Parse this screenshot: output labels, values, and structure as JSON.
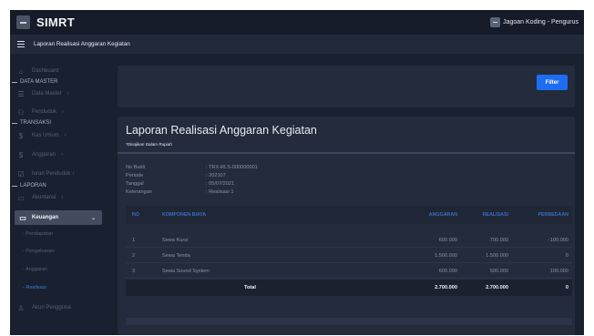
{
  "app": {
    "brand": "SIMRT",
    "user": "Jagoan Koding - Pengurus"
  },
  "subbar": {
    "title": "Laporan Realisasi Anggaran Kegiatan"
  },
  "sidebar": {
    "items": [
      {
        "label": "Dashboard",
        "icon": "home-icon"
      },
      {
        "header": "DATA MASTER"
      },
      {
        "label": "Data Master",
        "icon": "database-icon"
      },
      {
        "label": "Penduduk",
        "icon": "users-icon"
      },
      {
        "header": "TRANSAKSI"
      },
      {
        "label": "Kas Umum",
        "icon": "dollar-icon"
      },
      {
        "label": "Anggaran",
        "icon": "dollar-icon"
      },
      {
        "label": "Iuran Penduduk",
        "icon": "checkbox-icon"
      },
      {
        "header": "LAPORAN"
      },
      {
        "label": "Akuntansi",
        "icon": "monitor-icon"
      },
      {
        "label": "Keuangan",
        "icon": "monitor-icon"
      },
      {
        "label": "- Pendapatan"
      },
      {
        "label": "- Pengeluaran"
      },
      {
        "label": "- Anggaran"
      },
      {
        "label": "- Realisasi"
      },
      {
        "label": "Akun Pengguna",
        "icon": "user-icon"
      }
    ]
  },
  "filter": {
    "button": "Filter"
  },
  "report": {
    "title": "Laporan Realisasi Anggaran Kegiatan",
    "note": "*Disajikan Dalam Rupiah",
    "meta": [
      {
        "label": "No Bukti",
        "value": ": TRX-RLS-000000001"
      },
      {
        "label": "Periode",
        "value": ": 202107"
      },
      {
        "label": "Tanggal",
        "value": ": 05/07/2021"
      },
      {
        "label": "Keterangan",
        "value": ": Realisasi 1"
      }
    ],
    "columns": [
      "NO",
      "KOMPONEN BIAYA",
      "ANGGARAN",
      "REALISASI",
      "PERBEDAAN"
    ],
    "rows": [
      [
        "1",
        "Sewa Kursi",
        "600.000",
        "700.000",
        "-100.000"
      ],
      [
        "2",
        "Sewa Tenda",
        "1.500.000",
        "1.500.000",
        "0"
      ],
      [
        "3",
        "Sewa Sound System",
        "600.000",
        "500.000",
        "100.000"
      ]
    ],
    "total": {
      "label": "Total",
      "anggaran": "2.700.000",
      "realisasi": "2.700.000",
      "perbedaan": "0"
    }
  }
}
